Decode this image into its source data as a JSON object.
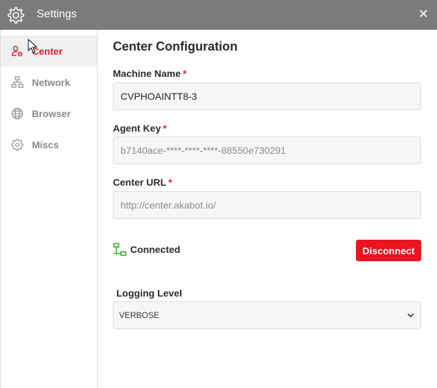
{
  "window": {
    "title": "Settings",
    "close_glyph": "✕"
  },
  "sidebar": {
    "items": [
      {
        "label": "Center",
        "icon": "user-settings-icon",
        "active": true
      },
      {
        "label": "Network",
        "icon": "network-icon",
        "active": false
      },
      {
        "label": "Browser",
        "icon": "globe-icon",
        "active": false
      },
      {
        "label": "Miscs",
        "icon": "gear-icon",
        "active": false
      }
    ]
  },
  "main": {
    "heading": "Center Configuration",
    "machine_name": {
      "label": "Machine Name",
      "required_mark": "*",
      "value": "CVPHOAINTT8-3"
    },
    "agent_key": {
      "label": "Agent Key",
      "required_mark": "*",
      "value": "b7140ace-****-****-****-88550e730291"
    },
    "center_url": {
      "label": "Center URL",
      "required_mark": "*",
      "value": "http://center.akabot.io/"
    },
    "status": {
      "text": "Connected",
      "icon": "network-connected-icon",
      "icon_color": "#3aa835"
    },
    "disconnect_button": {
      "label": "Disconnect"
    },
    "logging_level": {
      "label": "Logging Level",
      "selected": "VERBOSE"
    }
  },
  "colors": {
    "accent": "#e02030",
    "titlebar": "#7b7b7b",
    "button": "#e8141f"
  }
}
